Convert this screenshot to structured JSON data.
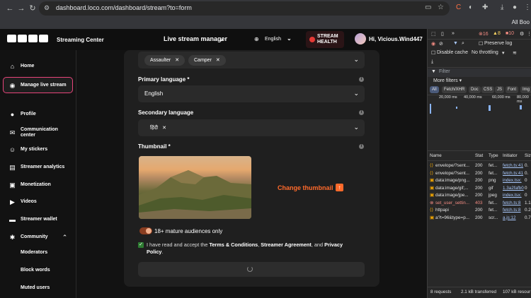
{
  "browser": {
    "url": "dashboard.loco.com/dashboard/stream?to=form",
    "bookmarks_label": "All Boo",
    "back_icon": "arrow-left-icon",
    "forward_icon": "arrow-right-icon",
    "reload_icon": "reload-icon"
  },
  "topbar": {
    "logo": "LOCO",
    "product": "Streaming Center",
    "page_title": "Live stream manager",
    "language": "English",
    "health_line1": "STREAM",
    "health_line2": "HEALTH",
    "greeting": "Hi, Vicious.Wind447"
  },
  "sidebar": {
    "items": [
      {
        "label": "Home",
        "icon": "home-icon"
      },
      {
        "label": "Manage live stream",
        "icon": "broadcast-icon"
      },
      {
        "label": "Profile",
        "icon": "user-icon"
      },
      {
        "label": "Communication center",
        "icon": "mail-icon"
      },
      {
        "label": "My stickers",
        "icon": "sticker-icon"
      },
      {
        "label": "Streamer analytics",
        "icon": "analytics-icon"
      },
      {
        "label": "Monetization",
        "icon": "monetization-icon"
      },
      {
        "label": "Videos",
        "icon": "video-icon"
      },
      {
        "label": "Streamer wallet",
        "icon": "wallet-icon"
      },
      {
        "label": "Community",
        "icon": "community-icon"
      }
    ],
    "community_sub": [
      "Moderators",
      "Block words",
      "Muted users"
    ]
  },
  "form": {
    "tags": [
      "Assaulter",
      "Camper"
    ],
    "primary_language_label": "Primary language *",
    "primary_language_value": "English",
    "secondary_language_label": "Secondary language",
    "secondary_language_tag": "हिंदी",
    "thumbnail_label": "Thumbnail *",
    "change_thumbnail": "Change thumbnail",
    "mature_label": "18+ mature audiences only",
    "mature_enabled": true,
    "terms_prefix": "I have read and accept the ",
    "terms_link1": "Terms & Conditions",
    "terms_sep1": ", ",
    "terms_link2": "Streamer Agreement",
    "terms_sep2": ", and ",
    "terms_link3": "Privacy Policy",
    "terms_suffix": ".",
    "terms_checked": true
  },
  "devtools": {
    "errors": "16",
    "warnings": "8",
    "issues": "10",
    "preserve_log": "Preserve log",
    "disable_cache": "Disable cache",
    "throttling": "No throttling",
    "filter_placeholder": "Filter",
    "more_filters": "More filters",
    "filter_chips": [
      "All",
      "Fetch/XHR",
      "Doc",
      "CSS",
      "JS",
      "Font",
      "Img"
    ],
    "timeline_ticks": [
      "20,000 ms",
      "40,000 ms",
      "60,000 ms",
      "80,000 ms"
    ],
    "columns": [
      "Name",
      "Stat",
      "Type",
      "Initiator",
      "Siz"
    ],
    "requests": [
      {
        "name": "envelope/?sent...",
        "status": "200",
        "type": "fet...",
        "initiator": "fetch.ts:41",
        "size": "0.",
        "error": false
      },
      {
        "name": "envelope/?sent...",
        "status": "200",
        "type": "fet...",
        "initiator": "fetch.ts:41",
        "size": "0.",
        "error": false
      },
      {
        "name": "data:image/png...",
        "status": "200",
        "type": "png",
        "initiator": "index.tsx:",
        "size": "0",
        "error": false
      },
      {
        "name": "data:image/gif;...",
        "status": "200",
        "type": "gif",
        "initiator": "1.3a2fafb0",
        "size": "0",
        "error": false
      },
      {
        "name": "data:image/jpe...",
        "status": "200",
        "type": "jpeg",
        "initiator": "index.tsx:",
        "size": "0",
        "error": false
      },
      {
        "name": "set_user_settin...",
        "status": "403",
        "type": "fet...",
        "initiator": "fetch.ts:8",
        "size": "1.1",
        "error": true
      },
      {
        "name": "httpapi",
        "status": "200",
        "type": "fet...",
        "initiator": "fetch.ts:8",
        "size": "0.2",
        "error": false
      },
      {
        "name": "a?t=96&type=p...",
        "status": "200",
        "type": "scr...",
        "initiator": "a.js:12",
        "size": "0.7",
        "error": false
      }
    ],
    "summary_requests": "8 requests",
    "summary_transferred": "2.1 kB transferred",
    "summary_resources": "107 kB resour"
  }
}
